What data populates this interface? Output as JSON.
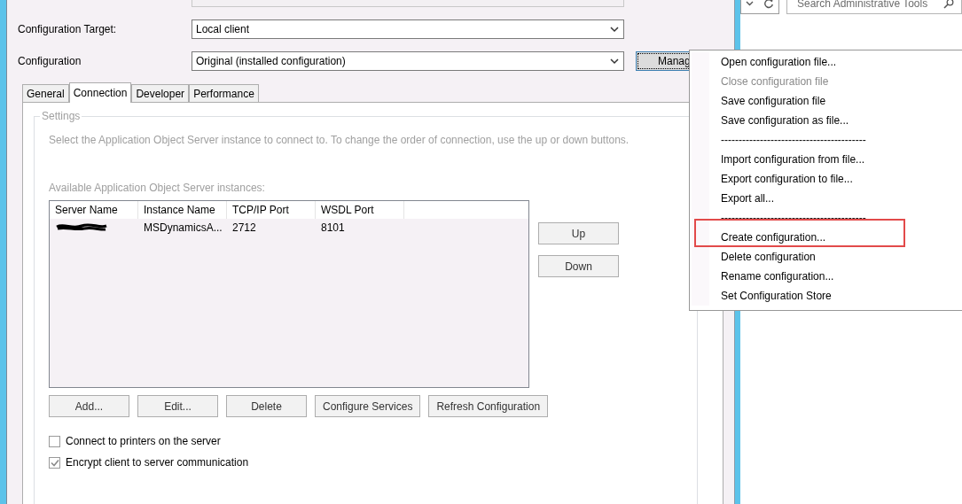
{
  "dialog": {
    "fields": [
      {
        "label": "Configuration Target:",
        "value": "Local client"
      },
      {
        "label": "Configuration",
        "value": "Original (installed configuration)"
      }
    ],
    "manage_button": "Manag",
    "tabs": [
      {
        "label": "General",
        "selected": false
      },
      {
        "label": "Connection",
        "selected": true
      },
      {
        "label": "Developer",
        "selected": false
      },
      {
        "label": "Performance",
        "selected": false
      }
    ],
    "settings": {
      "legend": "Settings",
      "description": "Select the Application Object Server instance to connect to. To change the order of connection, use the up or down buttons.",
      "list_label": "Available Application Object Server instances:",
      "columns": [
        "Server Name",
        "Instance Name",
        "TCP/IP Port",
        "WSDL Port"
      ],
      "rows": [
        {
          "cells": [
            {
              "kind": "redacted"
            },
            {
              "kind": "text",
              "text": "MSDynamicsA..."
            },
            {
              "kind": "text",
              "text": "2712"
            },
            {
              "kind": "text",
              "text": "8101"
            }
          ]
        }
      ],
      "side_buttons": [
        "Up",
        "Down"
      ],
      "buttons": [
        "Add...",
        "Edit...",
        "Delete",
        "Configure Services",
        "Refresh Configuration"
      ],
      "checkboxes": [
        {
          "label": "Connect to printers on the server",
          "checked": false
        },
        {
          "label": "Encrypt client to server communication",
          "checked": true
        }
      ]
    }
  },
  "explorer": {
    "search": {
      "placeholder": "Search Administrative Tools"
    }
  },
  "menu": {
    "items": [
      {
        "kind": "item",
        "label": "Open configuration file...",
        "disabled": false,
        "highlighted": false
      },
      {
        "kind": "item",
        "label": "Close configuration file",
        "disabled": true,
        "highlighted": false
      },
      {
        "kind": "item",
        "label": "Save configuration file",
        "disabled": false,
        "highlighted": false
      },
      {
        "kind": "item",
        "label": "Save configuration as file...",
        "disabled": false,
        "highlighted": false
      },
      {
        "kind": "separator",
        "label": "-----------------------------------------"
      },
      {
        "kind": "item",
        "label": "Import configuration from file...",
        "disabled": false,
        "highlighted": false
      },
      {
        "kind": "item",
        "label": "Export configuration to file...",
        "disabled": false,
        "highlighted": false
      },
      {
        "kind": "item",
        "label": "Export all...",
        "disabled": false,
        "highlighted": false
      },
      {
        "kind": "separator",
        "label": "-----------------------------------------"
      },
      {
        "kind": "item",
        "label": "Create configuration...",
        "disabled": false,
        "highlighted": true
      },
      {
        "kind": "item",
        "label": "Delete configuration",
        "disabled": false,
        "highlighted": false
      },
      {
        "kind": "item",
        "label": "Rename configuration...",
        "disabled": false,
        "highlighted": false
      },
      {
        "kind": "item",
        "label": "Set Configuration Store",
        "disabled": false,
        "highlighted": false
      }
    ]
  }
}
